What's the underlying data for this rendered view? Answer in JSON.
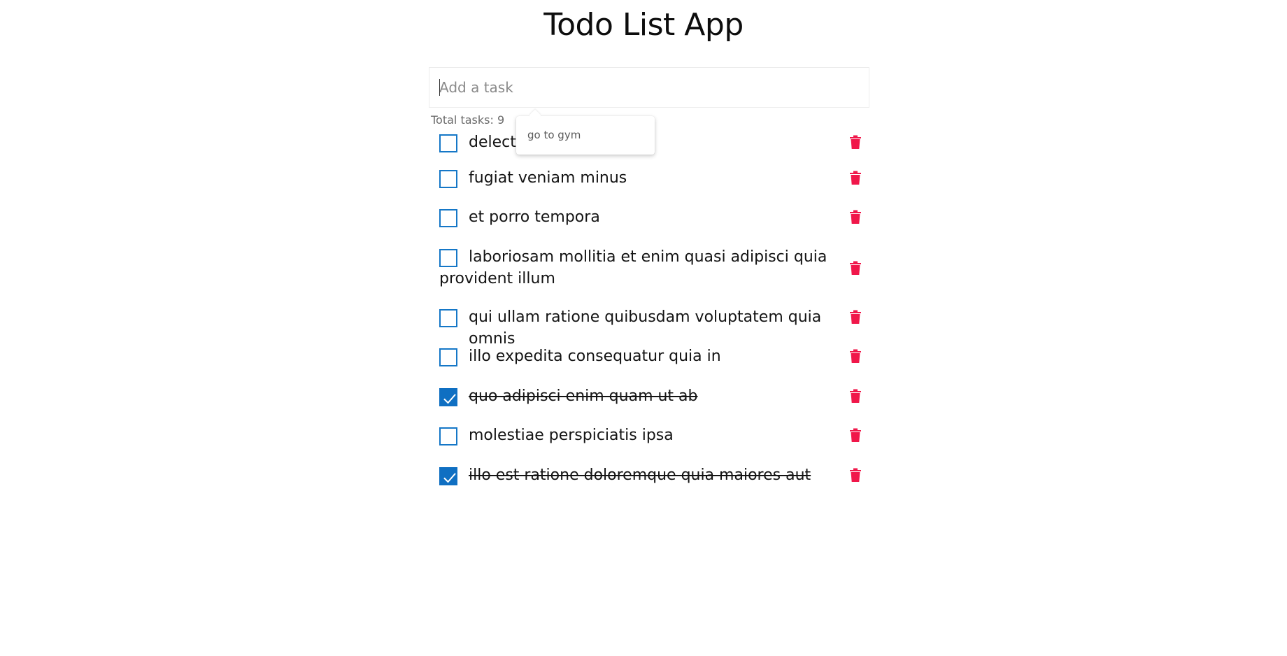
{
  "app": {
    "title": "Todo List App"
  },
  "input": {
    "placeholder": "Add a task",
    "value": ""
  },
  "summary": {
    "total_text": "Total tasks: 9"
  },
  "tooltip": {
    "text": "go to gym"
  },
  "tasks": [
    {
      "text": "delectus aut autem",
      "completed": false
    },
    {
      "text": "fugiat veniam minus",
      "completed": false
    },
    {
      "text": "et porro tempora",
      "completed": false
    },
    {
      "text": "laboriosam mollitia et enim quasi adipisci quia provident illum",
      "completed": false
    },
    {
      "text": "qui ullam ratione quibusdam voluptatem quia omnis",
      "completed": false
    },
    {
      "text": "illo expedita consequatur quia in",
      "completed": false
    },
    {
      "text": "quo adipisci enim quam ut ab",
      "completed": true
    },
    {
      "text": "molestiae perspiciatis ipsa",
      "completed": false
    },
    {
      "text": "illo est ratione doloremque quia maiores aut",
      "completed": true
    }
  ],
  "colors": {
    "checkbox": "#1577c7",
    "checkbox_checked": "#0f6fc2",
    "delete": "#f0174a"
  },
  "icons": {
    "delete": "trash-icon",
    "check": "checkmark-icon"
  }
}
